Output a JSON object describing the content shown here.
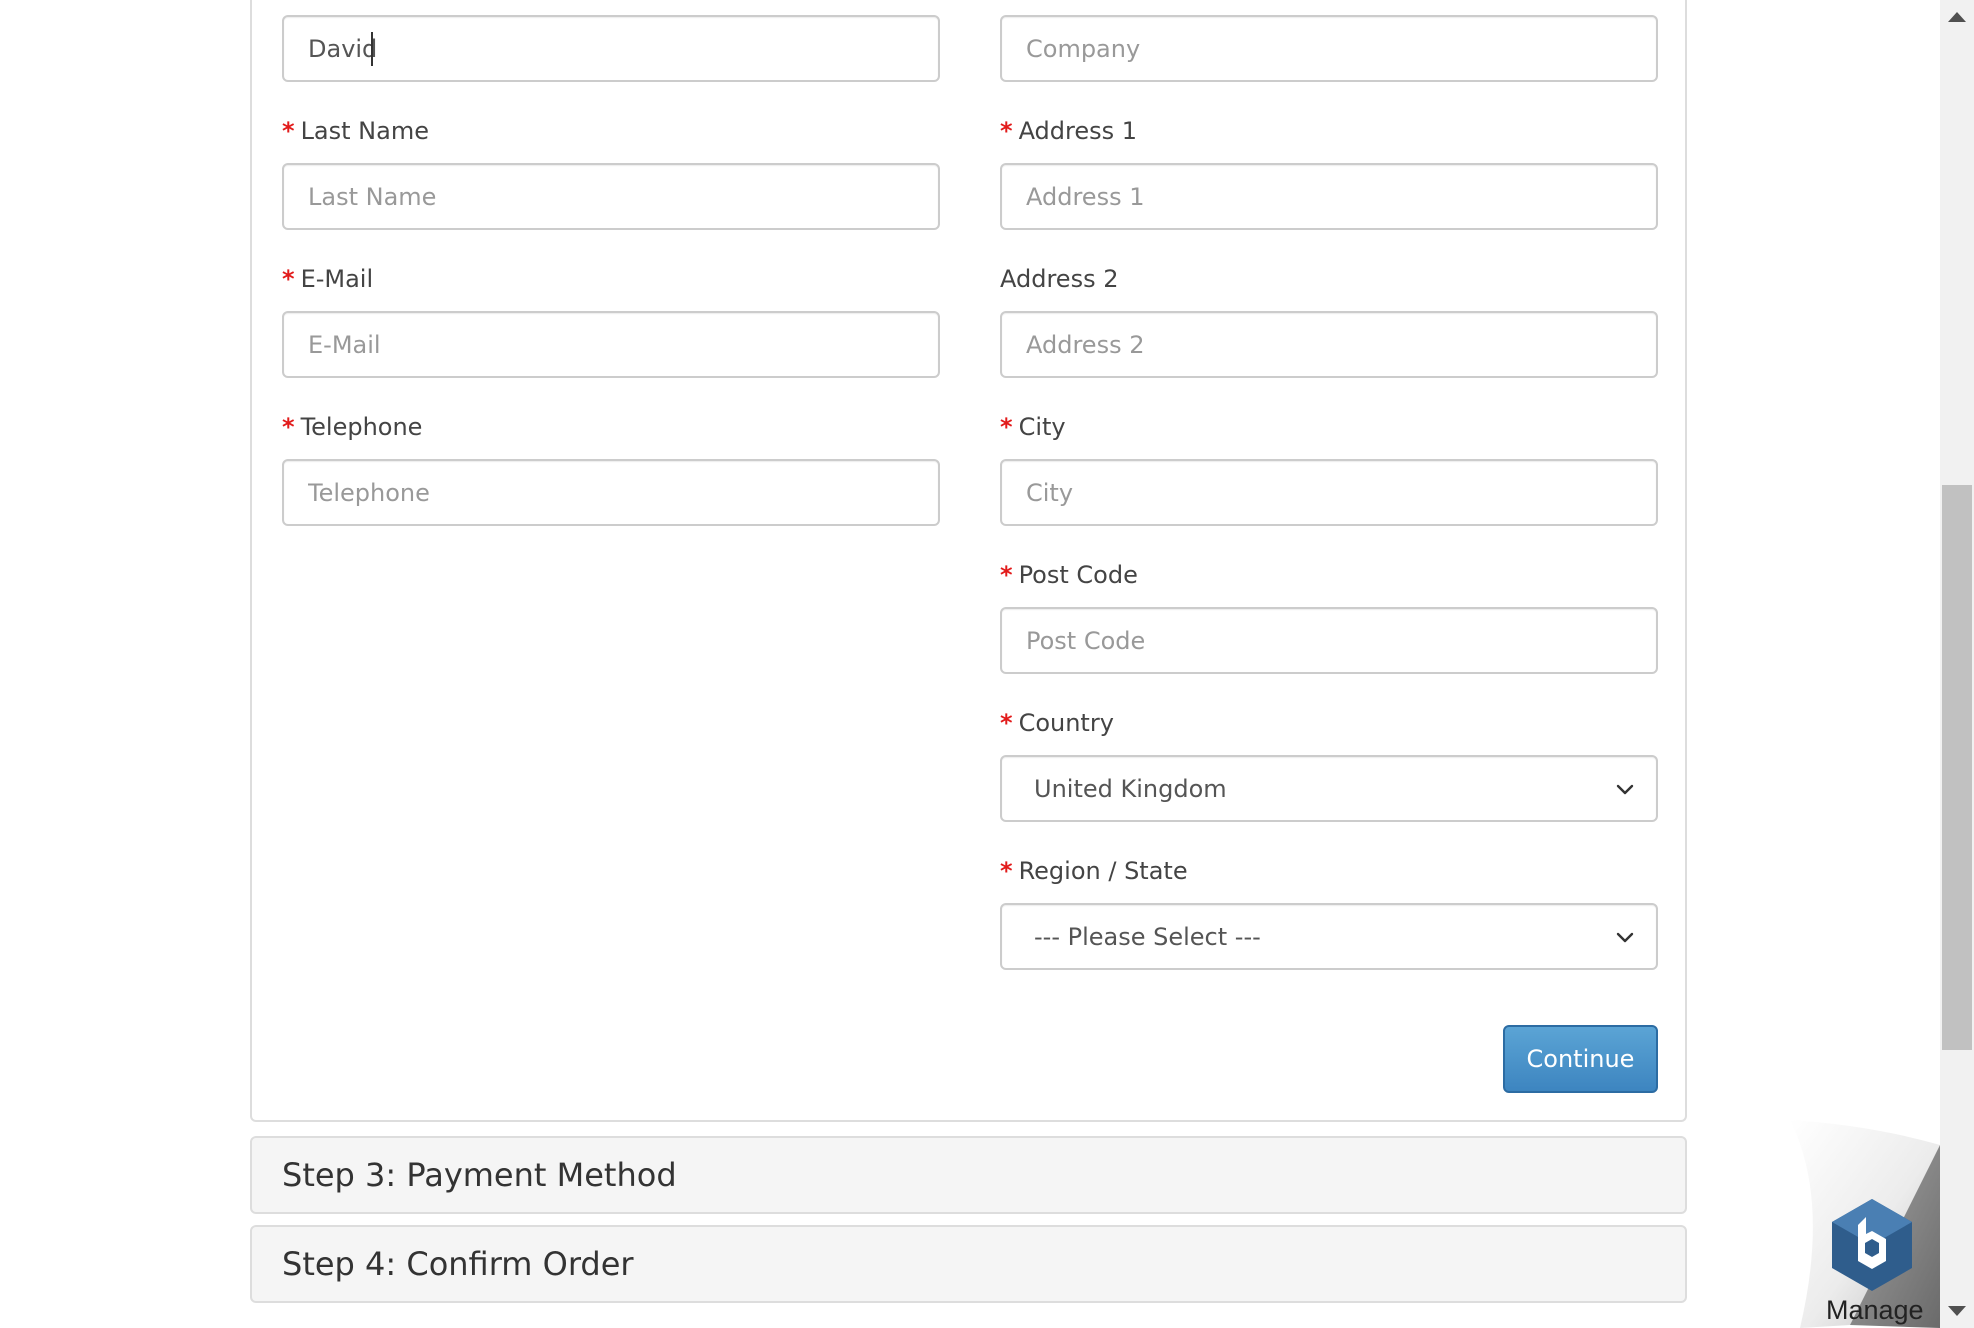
{
  "form": {
    "first_name": {
      "value": "David"
    },
    "company": {
      "placeholder": "Company"
    },
    "last_name": {
      "label": "Last Name",
      "placeholder": "Last Name"
    },
    "email": {
      "label": "E-Mail",
      "placeholder": "E-Mail"
    },
    "telephone": {
      "label": "Telephone",
      "placeholder": "Telephone"
    },
    "address1": {
      "label": "Address 1",
      "placeholder": "Address 1"
    },
    "address2": {
      "label": "Address 2",
      "placeholder": "Address 2"
    },
    "city": {
      "label": "City",
      "placeholder": "City"
    },
    "postcode": {
      "label": "Post Code",
      "placeholder": "Post Code"
    },
    "country": {
      "label": "Country",
      "selected": "United Kingdom"
    },
    "region": {
      "label": "Region / State",
      "selected": "--- Please Select ---"
    },
    "required_marker": "*",
    "continue_label": "Continue"
  },
  "steps": [
    {
      "label": "Step 3: Payment Method"
    },
    {
      "label": "Step 4: Confirm Order"
    }
  ],
  "badge": {
    "label": "Manage"
  },
  "colors": {
    "required": "#e21b1b",
    "button": "#3d85c0",
    "badge": "#2f5d8c"
  }
}
